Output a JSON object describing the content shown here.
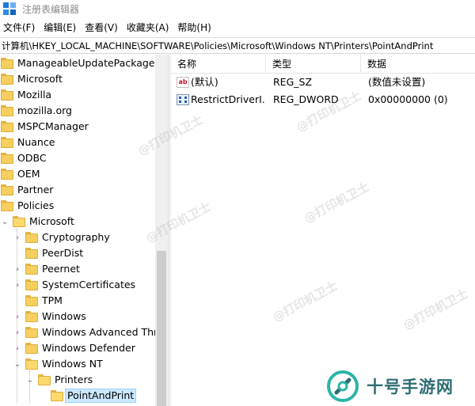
{
  "window": {
    "title": "注册表编辑器",
    "icon": "registry-editor-icon"
  },
  "menu": [
    {
      "label": "文件(F)"
    },
    {
      "label": "编辑(E)"
    },
    {
      "label": "查看(V)"
    },
    {
      "label": "收藏夹(A)"
    },
    {
      "label": "帮助(H)"
    }
  ],
  "address": {
    "path": "计算机\\HKEY_LOCAL_MACHINE\\SOFTWARE\\Policies\\Microsoft\\Windows NT\\Printers\\PointAndPrint"
  },
  "tree": {
    "items": [
      {
        "label": "ManageableUpdatePackage"
      },
      {
        "label": "Microsoft"
      },
      {
        "label": "Mozilla"
      },
      {
        "label": "mozilla.org"
      },
      {
        "label": "MSPCManager"
      },
      {
        "label": "Nuance"
      },
      {
        "label": "ODBC"
      },
      {
        "label": "OEM"
      },
      {
        "label": "Partner"
      },
      {
        "label": "Policies"
      },
      {
        "label": "Microsoft"
      },
      {
        "label": "Cryptography"
      },
      {
        "label": "PeerDist"
      },
      {
        "label": "Peernet"
      },
      {
        "label": "SystemCertificates"
      },
      {
        "label": "TPM"
      },
      {
        "label": "Windows"
      },
      {
        "label": "Windows Advanced Threat Protection"
      },
      {
        "label": "Windows Defender"
      },
      {
        "label": "Windows NT"
      },
      {
        "label": "Printers"
      },
      {
        "label": "PointAndPrint"
      }
    ]
  },
  "list": {
    "columns": {
      "name": "名称",
      "type": "类型",
      "data": "数据"
    },
    "rows": [
      {
        "icon": "string-value-icon",
        "name": "(默认)",
        "type": "REG_SZ",
        "data": "(数值未设置)"
      },
      {
        "icon": "dword-value-icon",
        "name": "RestrictDriverI...",
        "type": "REG_DWORD",
        "data": "0x00000000 (0)"
      }
    ]
  },
  "watermark": {
    "text": "@打印机卫士"
  },
  "brand": {
    "text": "十号手游网",
    "color": "#2d6d74",
    "accent": "#2bb5a8"
  }
}
